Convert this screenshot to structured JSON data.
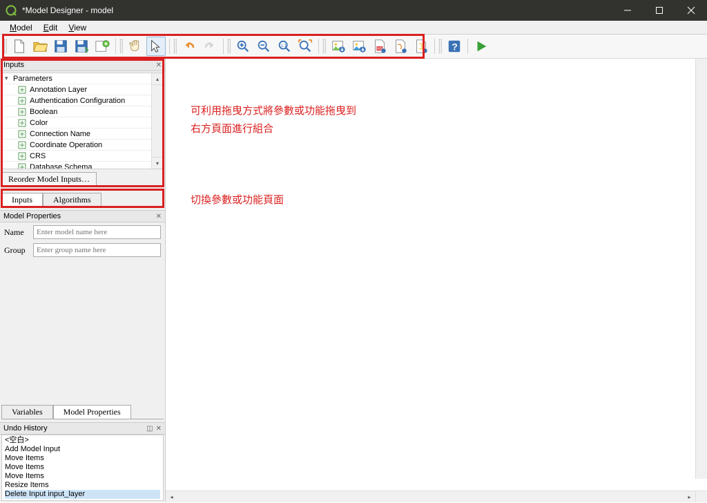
{
  "window": {
    "title": "*Model Designer - model"
  },
  "menus": {
    "model": "Model",
    "edit": "Edit",
    "view": "View"
  },
  "panels": {
    "inputs_title": "Inputs",
    "parameters_label": "Parameters",
    "items": [
      "Annotation Layer",
      "Authentication Configuration",
      "Boolean",
      "Color",
      "Connection Name",
      "Coordinate Operation",
      "CRS",
      "Database Schema"
    ],
    "reorder_button": "Reorder Model Inputs…",
    "tab_inputs": "Inputs",
    "tab_algorithms": "Algorithms",
    "model_props_title": "Model Properties",
    "name_label": "Name",
    "name_placeholder": "Enter model name here",
    "group_label": "Group",
    "group_placeholder": "Enter group name here",
    "tab_variables": "Variables",
    "tab_model_properties": "Model Properties",
    "undo_title": "Undo History",
    "undo_items": [
      "<空白>",
      "Add Model Input",
      "Move Items",
      "Move Items",
      "Move Items",
      "Resize Items",
      "Delete Input input_layer"
    ]
  },
  "annotations": {
    "drag_hint_line1": "可利用拖曳方式將參數或功能拖曳到",
    "drag_hint_line2": "右方頁面進行組合",
    "tab_hint": "切換參數或功能頁面"
  }
}
